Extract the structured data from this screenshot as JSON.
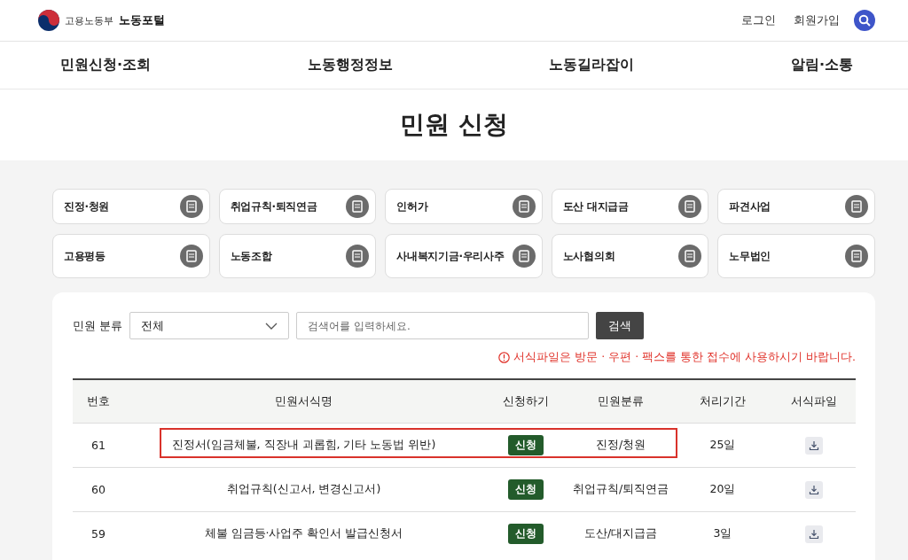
{
  "header": {
    "ministry": "고용노동부",
    "portal": "노동포털",
    "links": [
      "로그인",
      "회원가입"
    ]
  },
  "nav": [
    "민원신청·조회",
    "노동행정정보",
    "노동길라잡이",
    "알림·소통"
  ],
  "page_title": "민원 신청",
  "categories": [
    {
      "label": "진정·청원"
    },
    {
      "label": "취업규칙·퇴직연금"
    },
    {
      "label": "인허가"
    },
    {
      "label": "도산 대지급금"
    },
    {
      "label": "파견사업"
    },
    {
      "label": "고용평등"
    },
    {
      "label": "노동조합"
    },
    {
      "label": "사내복지기금·우리사주"
    },
    {
      "label": "노사협의회"
    },
    {
      "label": "노무법인"
    }
  ],
  "filter": {
    "label": "민원 분류",
    "select_value": "전체",
    "placeholder": "검색어를 입력하세요.",
    "button": "검색"
  },
  "notice": "서식파일은 방문 · 우편 · 팩스를 통한 접수에 사용하시기 바랍니다.",
  "table": {
    "columns": [
      "번호",
      "민원서식명",
      "신청하기",
      "민원분류",
      "처리기간",
      "서식파일"
    ],
    "rows": [
      {
        "number": "61",
        "name": "진정서(임금체불, 직장내 괴롭힘, 기타 노동법 위반)",
        "apply": "신청",
        "category": "진정/청원",
        "period": "25일",
        "highlighted": true
      },
      {
        "number": "60",
        "name": "취업규칙(신고서, 변경신고서)",
        "apply": "신청",
        "category": "취업규칙/퇴직연금",
        "period": "20일",
        "highlighted": false
      },
      {
        "number": "59",
        "name": "체불 임금등·사업주 확인서 발급신청서",
        "apply": "신청",
        "category": "도산/대지급금",
        "period": "3일",
        "highlighted": false
      }
    ]
  }
}
